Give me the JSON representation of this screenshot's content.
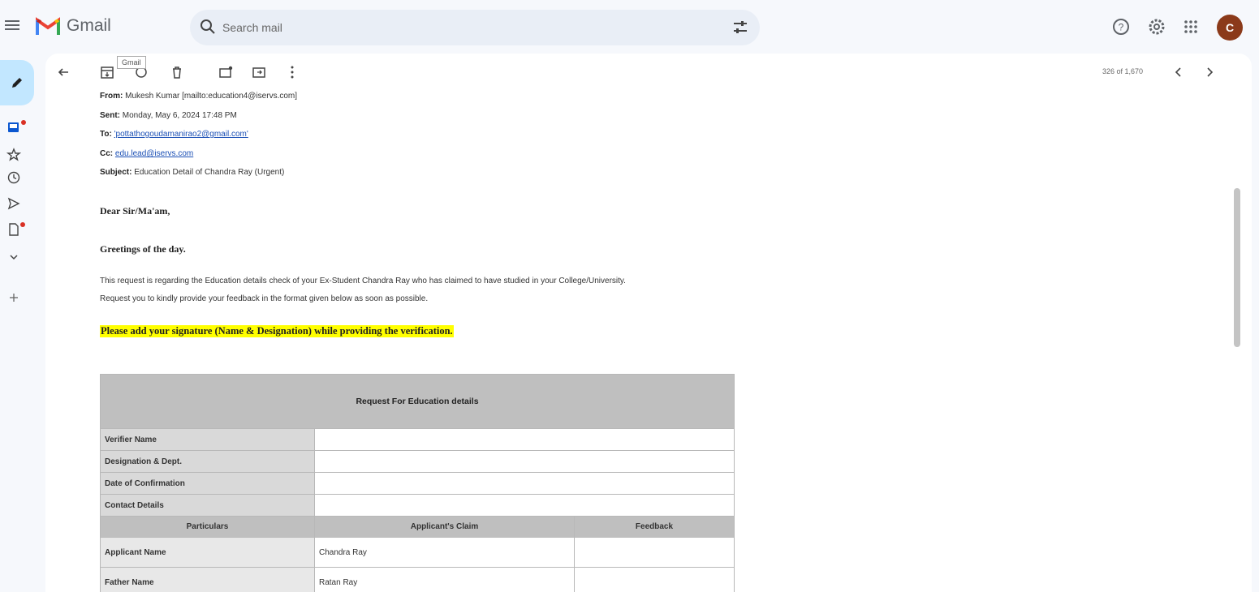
{
  "app": {
    "name": "Gmail",
    "search_placeholder": "Search mail",
    "avatar_letter": "C"
  },
  "toolbar": {
    "tooltip": "Gmail",
    "pager": "326 of 1,670"
  },
  "email": {
    "from_label": "From:",
    "from_value": "Mukesh Kumar [mailto:education4@iservs.com]",
    "sent_label": "Sent:",
    "sent_value": "Monday, May 6, 2024 17:48 PM",
    "to_label": "To:",
    "to_value": "'pottathogoudamanirao2@gmail.com'",
    "cc_label": "Cc:",
    "cc_value": "edu.lead@iservs.com",
    "subject_label": "Subject:",
    "subject_value": "Education Detail of Chandra Ray (Urgent)",
    "salutation": "Dear Sir/Ma'am,",
    "greeting": "Greetings of the day.",
    "para1": "This request is regarding the Education details check of your Ex-Student Chandra Ray who has claimed to have studied in your College/University.",
    "para2": "Request you to kindly provide your feedback in the format given below as soon as possible.",
    "highlight": "Please add your signature (Name & Designation) while providing the verification."
  },
  "form": {
    "title": "Request For Education details",
    "rows": [
      "Verifier Name",
      "Designation & Dept.",
      "Date of Confirmation",
      "Contact Details"
    ],
    "headers": [
      "Particulars",
      "Applicant's Claim",
      "Feedback"
    ],
    "applicant_rows": [
      {
        "label": "Applicant Name",
        "claim": "Chandra Ray"
      },
      {
        "label": "Father Name",
        "claim": "Ratan Ray"
      }
    ]
  }
}
